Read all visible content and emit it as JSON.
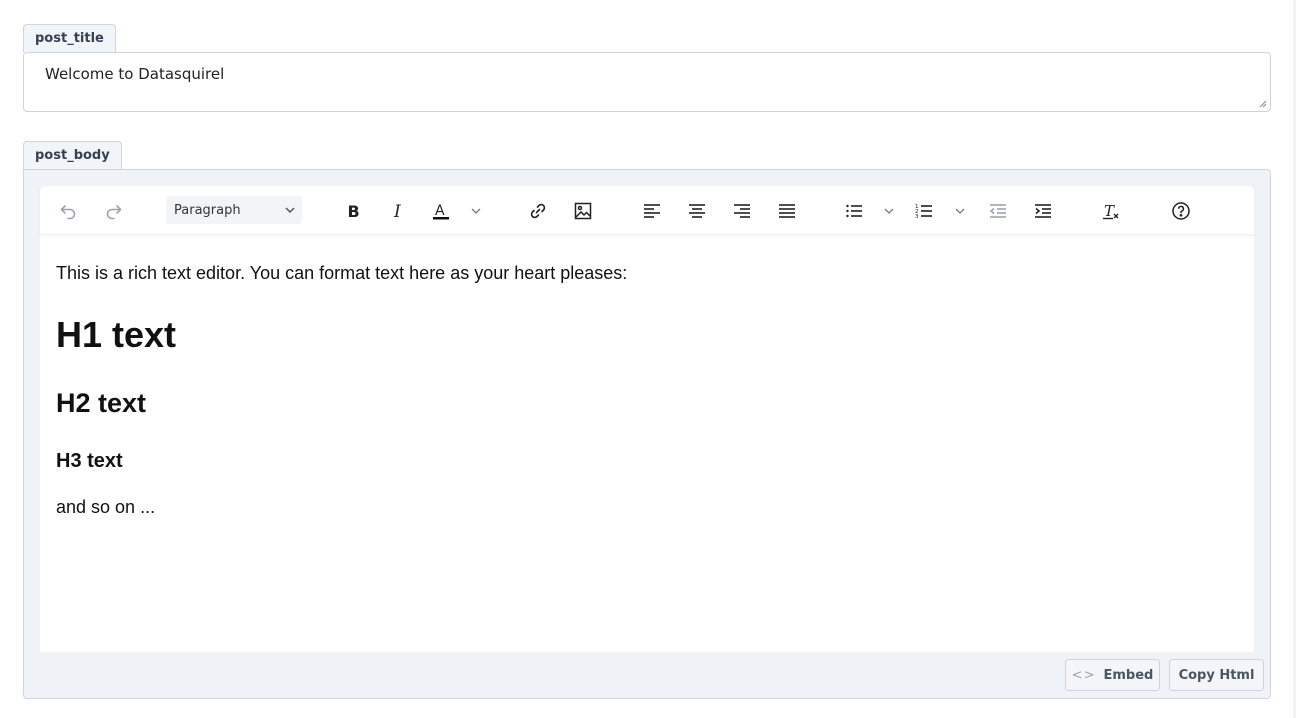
{
  "post_title": {
    "tab_label": "post_title",
    "value": "Welcome to Datasquirel"
  },
  "post_body": {
    "tab_label": "post_body",
    "toolbar": {
      "undo_icon": "undo-icon",
      "redo_icon": "redo-icon",
      "block_format": "Paragraph",
      "bold_icon": "bold-icon",
      "italic_icon": "italic-icon",
      "text_color_icon": "text-color-icon",
      "link_icon": "link-icon",
      "image_icon": "image-icon",
      "align_left_icon": "align-left-icon",
      "align_center_icon": "align-center-icon",
      "align_right_icon": "align-right-icon",
      "align_justify_icon": "align-justify-icon",
      "bullet_list_icon": "bullet-list-icon",
      "numbered_list_icon": "numbered-list-icon",
      "outdent_icon": "outdent-icon",
      "indent_icon": "indent-icon",
      "clear_format_icon": "clear-formatting-icon",
      "help_icon": "help-icon",
      "text_color": "#111111"
    },
    "content": {
      "intro": "This is a rich text editor. You can format text here as your heart pleases:",
      "h1": "H1 text",
      "h2": "H2 text",
      "h3": "H3 text",
      "outro": "and so on ..."
    },
    "footer": {
      "embed_label": "Embed",
      "copy_html_label": "Copy Html"
    }
  }
}
